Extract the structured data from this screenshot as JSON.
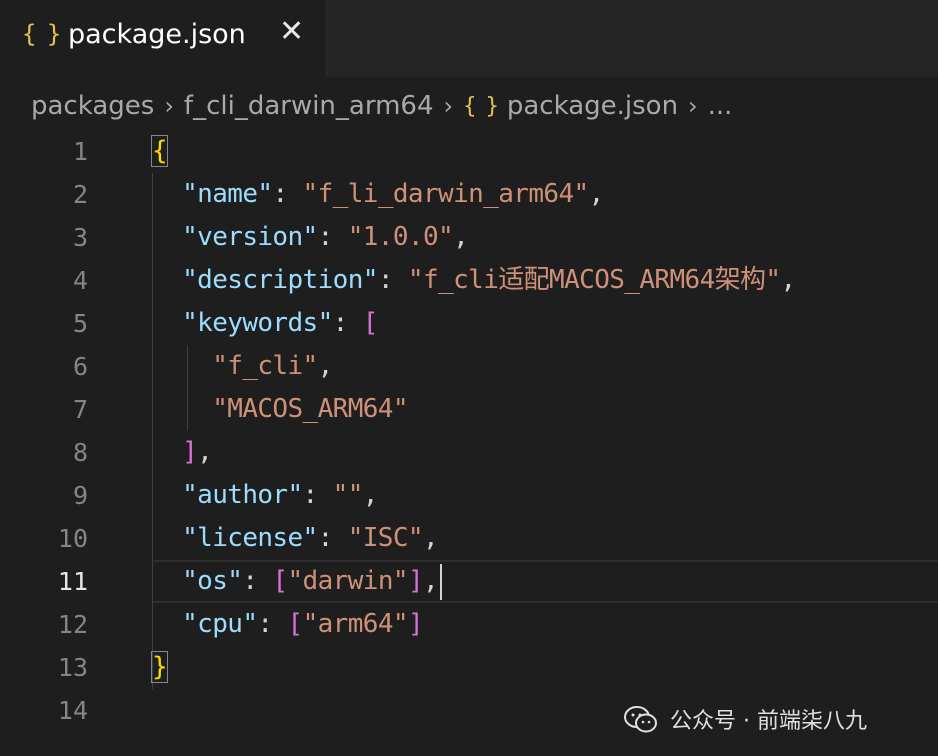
{
  "tab": {
    "icon": "json-braces-icon",
    "title": "package.json",
    "close_glyph": "✕"
  },
  "breadcrumb": {
    "items": [
      "packages",
      "f_cli_darwin_arm64",
      "package.json",
      "..."
    ],
    "separator": "›"
  },
  "editor": {
    "line_numbers": [
      "1",
      "2",
      "3",
      "4",
      "5",
      "6",
      "7",
      "8",
      "9",
      "10",
      "11",
      "12",
      "13",
      "14"
    ],
    "active_line": "11",
    "lines": [
      {
        "open": "{"
      },
      {
        "key": "\"name\"",
        "value": "\"f_li_darwin_arm64\"",
        "trail": ","
      },
      {
        "key": "\"version\"",
        "value": "\"1.0.0\"",
        "trail": ","
      },
      {
        "key": "\"description\"",
        "value": "\"f_cli适配MACOS_ARM64架构\"",
        "trail": ","
      },
      {
        "key": "\"keywords\"",
        "open_bracket": "["
      },
      {
        "item": "\"f_cli\"",
        "trail": ","
      },
      {
        "item": "\"MACOS_ARM64\""
      },
      {
        "close_bracket": "]",
        "trail": ","
      },
      {
        "key": "\"author\"",
        "value": "\"\"",
        "trail": ","
      },
      {
        "key": "\"license\"",
        "value": "\"ISC\"",
        "trail": ","
      },
      {
        "key": "\"os\"",
        "value": "\"darwin\"",
        "trail": ","
      },
      {
        "key": "\"cpu\"",
        "value": "\"arm64\""
      },
      {
        "close": "}"
      }
    ]
  },
  "watermark": {
    "icon": "wechat-icon",
    "text": "公众号 · 前端柒八九"
  },
  "colors": {
    "background": "#1e1e1e",
    "key": "#9cdcfe",
    "string": "#ce9178",
    "brace": "#ffd700",
    "bracket": "#da70d6"
  }
}
